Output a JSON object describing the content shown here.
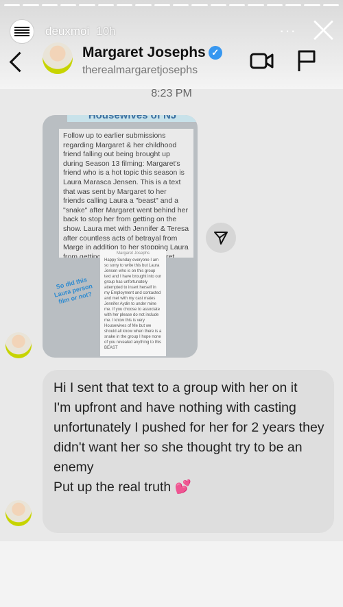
{
  "story": {
    "username": "deuxmoi",
    "time": "10h",
    "more_label": "···",
    "avatar_text": "DEUXMOI"
  },
  "header": {
    "name": "Margaret Josephs",
    "handle": "therealmargaretjosephs",
    "verified_mark": "✓"
  },
  "thread": {
    "timestamp": "8:23 PM"
  },
  "shared_post": {
    "title": "Housewives of NJ",
    "body": "Follow up to earlier submissions regarding Margaret & her childhood friend falling out being brought up during Season 13 filming: Margaret's friend who is a hot topic this season is Laura Marasca Jensen. This is a text that was sent by Margaret to her friends calling Laura a \"beast\" and a \"snake\" after Margaret went behind her back to stop her from getting on the show. Laura met with Jennifer & Teresa after countless acts of betrayal from Marge in addition to her stopping Laura from getting on the show. Margaret didn't like that Laura met with them.",
    "screenshot_header": "Margaret Josephs",
    "screenshot_text": "Happy Sunday everyone I am so sorry to write this but Laura Jensen who is on this group text and I have brought into our group has unfortunately attempted to insert herself in my Employment and contacted and met with my cast mates Jennifer Aydin to under mine me. If you choose to associate with her please do not include me. I know this is very Housewives of Me but we should all know when there is a snake in the group I hope none of you revealed anything to this BEAST",
    "annotation": "So did this Laura person film or not?"
  },
  "reply": {
    "lines": [
      "Hi I sent that text to a group with her on it",
      "I'm upfront and have nothing with casting unfortunately I pushed for her for 2 years they didn't want her so she thought try to be an enemy",
      "Put up the real truth 💕"
    ]
  }
}
